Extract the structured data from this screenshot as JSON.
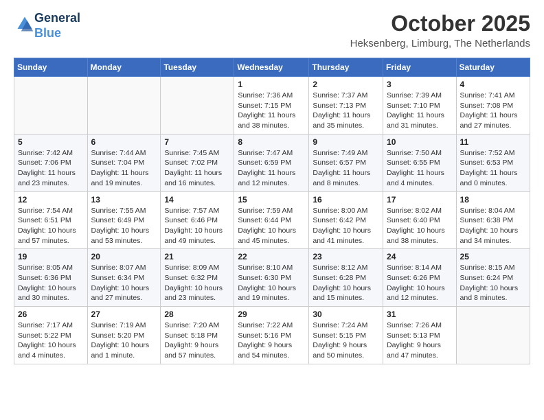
{
  "header": {
    "logo_line1": "General",
    "logo_line2": "Blue",
    "month": "October 2025",
    "location": "Heksenberg, Limburg, The Netherlands"
  },
  "days_of_week": [
    "Sunday",
    "Monday",
    "Tuesday",
    "Wednesday",
    "Thursday",
    "Friday",
    "Saturday"
  ],
  "weeks": [
    [
      {
        "day": "",
        "info": ""
      },
      {
        "day": "",
        "info": ""
      },
      {
        "day": "",
        "info": ""
      },
      {
        "day": "1",
        "info": "Sunrise: 7:36 AM\nSunset: 7:15 PM\nDaylight: 11 hours and 38 minutes."
      },
      {
        "day": "2",
        "info": "Sunrise: 7:37 AM\nSunset: 7:13 PM\nDaylight: 11 hours and 35 minutes."
      },
      {
        "day": "3",
        "info": "Sunrise: 7:39 AM\nSunset: 7:10 PM\nDaylight: 11 hours and 31 minutes."
      },
      {
        "day": "4",
        "info": "Sunrise: 7:41 AM\nSunset: 7:08 PM\nDaylight: 11 hours and 27 minutes."
      }
    ],
    [
      {
        "day": "5",
        "info": "Sunrise: 7:42 AM\nSunset: 7:06 PM\nDaylight: 11 hours and 23 minutes."
      },
      {
        "day": "6",
        "info": "Sunrise: 7:44 AM\nSunset: 7:04 PM\nDaylight: 11 hours and 19 minutes."
      },
      {
        "day": "7",
        "info": "Sunrise: 7:45 AM\nSunset: 7:02 PM\nDaylight: 11 hours and 16 minutes."
      },
      {
        "day": "8",
        "info": "Sunrise: 7:47 AM\nSunset: 6:59 PM\nDaylight: 11 hours and 12 minutes."
      },
      {
        "day": "9",
        "info": "Sunrise: 7:49 AM\nSunset: 6:57 PM\nDaylight: 11 hours and 8 minutes."
      },
      {
        "day": "10",
        "info": "Sunrise: 7:50 AM\nSunset: 6:55 PM\nDaylight: 11 hours and 4 minutes."
      },
      {
        "day": "11",
        "info": "Sunrise: 7:52 AM\nSunset: 6:53 PM\nDaylight: 11 hours and 0 minutes."
      }
    ],
    [
      {
        "day": "12",
        "info": "Sunrise: 7:54 AM\nSunset: 6:51 PM\nDaylight: 10 hours and 57 minutes."
      },
      {
        "day": "13",
        "info": "Sunrise: 7:55 AM\nSunset: 6:49 PM\nDaylight: 10 hours and 53 minutes."
      },
      {
        "day": "14",
        "info": "Sunrise: 7:57 AM\nSunset: 6:46 PM\nDaylight: 10 hours and 49 minutes."
      },
      {
        "day": "15",
        "info": "Sunrise: 7:59 AM\nSunset: 6:44 PM\nDaylight: 10 hours and 45 minutes."
      },
      {
        "day": "16",
        "info": "Sunrise: 8:00 AM\nSunset: 6:42 PM\nDaylight: 10 hours and 41 minutes."
      },
      {
        "day": "17",
        "info": "Sunrise: 8:02 AM\nSunset: 6:40 PM\nDaylight: 10 hours and 38 minutes."
      },
      {
        "day": "18",
        "info": "Sunrise: 8:04 AM\nSunset: 6:38 PM\nDaylight: 10 hours and 34 minutes."
      }
    ],
    [
      {
        "day": "19",
        "info": "Sunrise: 8:05 AM\nSunset: 6:36 PM\nDaylight: 10 hours and 30 minutes."
      },
      {
        "day": "20",
        "info": "Sunrise: 8:07 AM\nSunset: 6:34 PM\nDaylight: 10 hours and 27 minutes."
      },
      {
        "day": "21",
        "info": "Sunrise: 8:09 AM\nSunset: 6:32 PM\nDaylight: 10 hours and 23 minutes."
      },
      {
        "day": "22",
        "info": "Sunrise: 8:10 AM\nSunset: 6:30 PM\nDaylight: 10 hours and 19 minutes."
      },
      {
        "day": "23",
        "info": "Sunrise: 8:12 AM\nSunset: 6:28 PM\nDaylight: 10 hours and 15 minutes."
      },
      {
        "day": "24",
        "info": "Sunrise: 8:14 AM\nSunset: 6:26 PM\nDaylight: 10 hours and 12 minutes."
      },
      {
        "day": "25",
        "info": "Sunrise: 8:15 AM\nSunset: 6:24 PM\nDaylight: 10 hours and 8 minutes."
      }
    ],
    [
      {
        "day": "26",
        "info": "Sunrise: 7:17 AM\nSunset: 5:22 PM\nDaylight: 10 hours and 4 minutes."
      },
      {
        "day": "27",
        "info": "Sunrise: 7:19 AM\nSunset: 5:20 PM\nDaylight: 10 hours and 1 minute."
      },
      {
        "day": "28",
        "info": "Sunrise: 7:20 AM\nSunset: 5:18 PM\nDaylight: 9 hours and 57 minutes."
      },
      {
        "day": "29",
        "info": "Sunrise: 7:22 AM\nSunset: 5:16 PM\nDaylight: 9 hours and 54 minutes."
      },
      {
        "day": "30",
        "info": "Sunrise: 7:24 AM\nSunset: 5:15 PM\nDaylight: 9 hours and 50 minutes."
      },
      {
        "day": "31",
        "info": "Sunrise: 7:26 AM\nSunset: 5:13 PM\nDaylight: 9 hours and 47 minutes."
      },
      {
        "day": "",
        "info": ""
      }
    ]
  ]
}
